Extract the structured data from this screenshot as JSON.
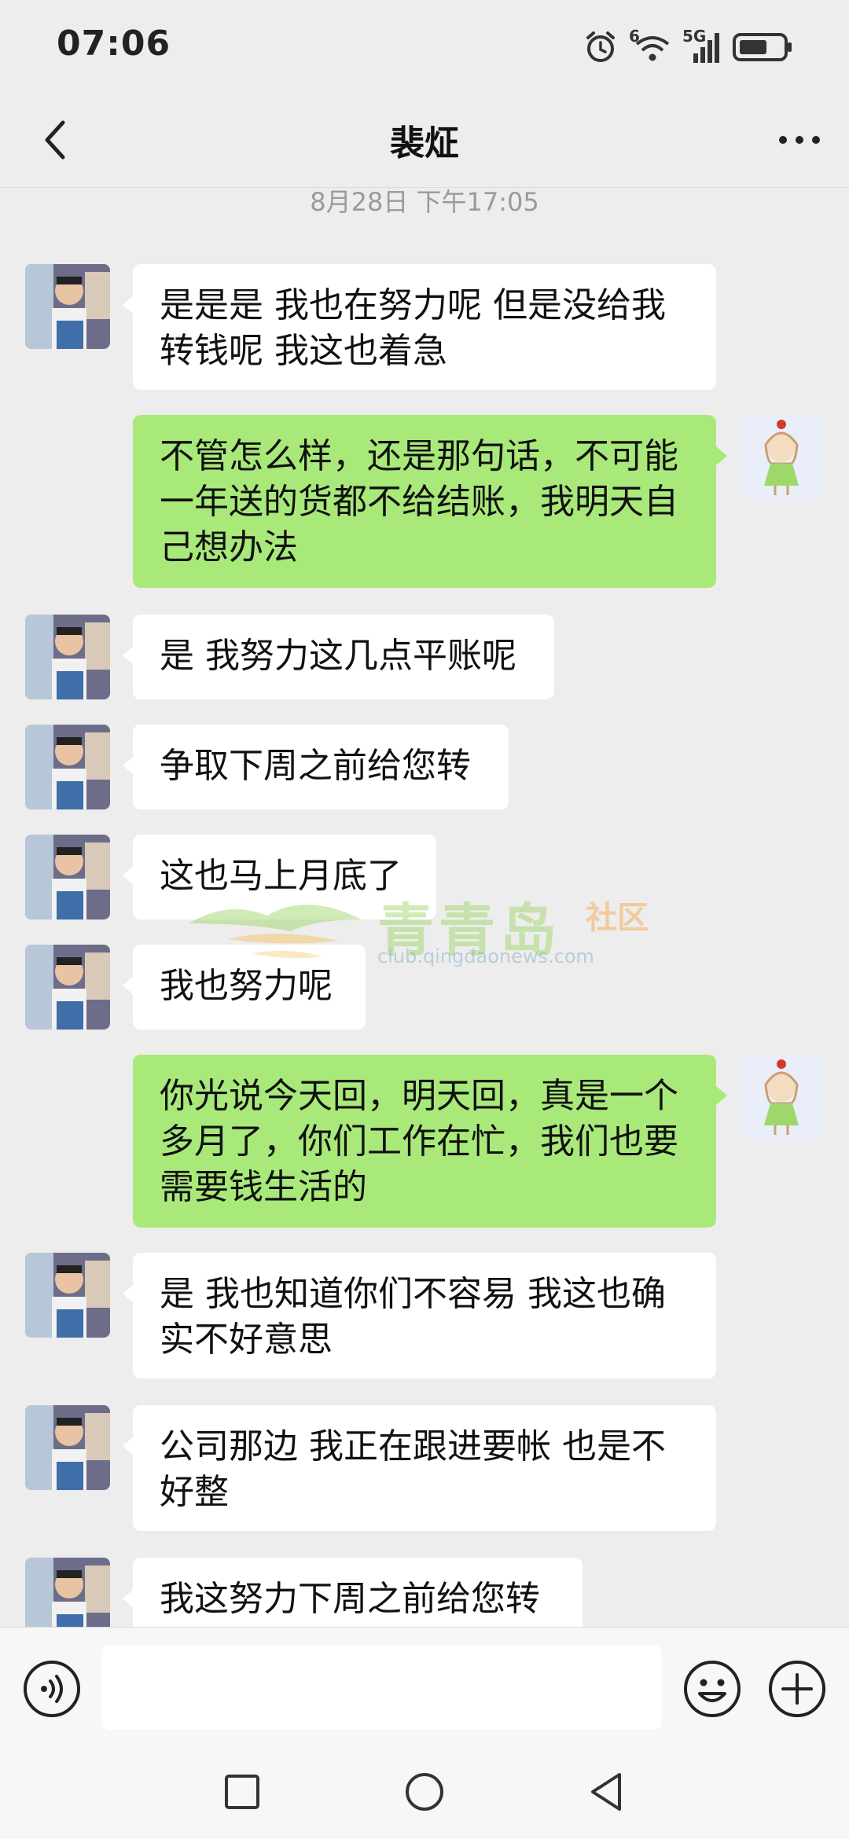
{
  "status_bar": {
    "time": "07:06",
    "network_label": "5G",
    "wifi_label": "6",
    "icons": [
      "alarm-icon",
      "wifi-icon",
      "signal-icon",
      "battery-icon"
    ]
  },
  "header": {
    "title": "裴炡",
    "back_icon": "chevron-left-icon",
    "more_icon": "more-dots-icon"
  },
  "timestamp": "8月28日 下午17:05",
  "messages": [
    {
      "side": "left",
      "text": "是是是 我也在努力呢 但是没给我\n转钱呢 我这也着急"
    },
    {
      "side": "right",
      "text": "不管怎么样，还是那句话，不可能\n一年送的货都不给结账，我明天自\n己想办法"
    },
    {
      "side": "left",
      "text": "是 我努力这几点平账呢"
    },
    {
      "side": "left",
      "text": "争取下周之前给您转"
    },
    {
      "side": "left",
      "text": "这也马上月底了"
    },
    {
      "side": "left",
      "text": "我也努力呢"
    },
    {
      "side": "right",
      "text": "你光说今天回，明天回，真是一个\n多月了，你们工作在忙，我们也要\n需要钱生活的"
    },
    {
      "side": "left",
      "text": "是 我也知道你们不容易 我这也确\n实不好意思"
    },
    {
      "side": "left",
      "text": "公司那边 我正在跟进要帐 也是不\n好整"
    },
    {
      "side": "left",
      "text": "我这努力下周之前给您转"
    }
  ],
  "watermark": {
    "title": "青青岛",
    "tag": "社区",
    "url": "club.qingdaonews.com"
  },
  "input_bar": {
    "placeholder": "",
    "voice_icon": "voice-icon",
    "emoji_icon": "emoji-icon",
    "plus_icon": "plus-icon"
  },
  "nav_bar": {
    "icons": [
      "recent-apps-icon",
      "home-icon",
      "back-icon"
    ]
  },
  "colors": {
    "background": "#ededed",
    "bubble_self": "#a9e97a",
    "bubble_other": "#ffffff"
  }
}
